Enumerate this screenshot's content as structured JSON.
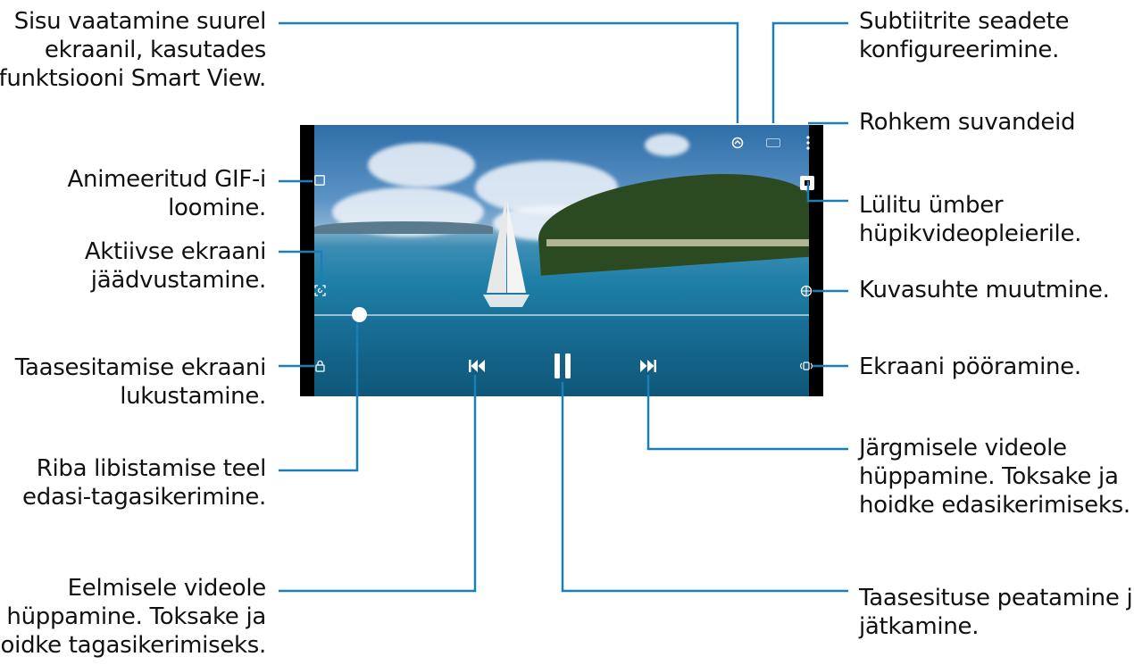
{
  "callouts": {
    "smart_view": [
      "Sisu vaatamine suurel",
      "ekraanil, kasutades",
      "funktsiooni Smart View."
    ],
    "subtitles": [
      "Subtiitrite seadete",
      "konfigureerimine."
    ],
    "more_options": [
      "Rohkem suvandeid"
    ],
    "gif": [
      "Animeeritud GIF-i",
      "loomine."
    ],
    "popup": [
      "Lülitu ümber",
      "hüpikvideopleierile."
    ],
    "capture": [
      "Aktiivse ekraani",
      "jäädvustamine."
    ],
    "ratio": [
      "Kuvasuhte muutmine."
    ],
    "lock": [
      "Taasesitamise ekraani",
      "lukustamine."
    ],
    "rotate": [
      "Ekraani pööramine."
    ],
    "seek": [
      "Riba libistamise teel",
      "edasi-tagasikerimine."
    ],
    "next": [
      "Järgmisele videole",
      "hüppamine. Toksake ja",
      "hoidke edasikerimiseks."
    ],
    "previous": [
      "Eelmisele videole",
      "hüppamine. Toksake ja",
      "hoidke tagasikerimiseks."
    ],
    "pause": [
      "Taasesituse peatamine ja",
      "jätkamine."
    ]
  },
  "player": {
    "progress": 0.09,
    "icons": {
      "smart_view": "smart-view-icon",
      "subtitles": "subtitles-icon",
      "more": "more-options-icon",
      "gif": "gif-icon",
      "popup": "popup-player-icon",
      "capture": "capture-icon",
      "ratio": "ratio-icon",
      "lock": "lock-icon",
      "rotate": "rotate-icon",
      "previous": "previous-icon",
      "pause": "pause-icon",
      "next": "next-icon"
    },
    "line_color": "#1a7fb8"
  }
}
